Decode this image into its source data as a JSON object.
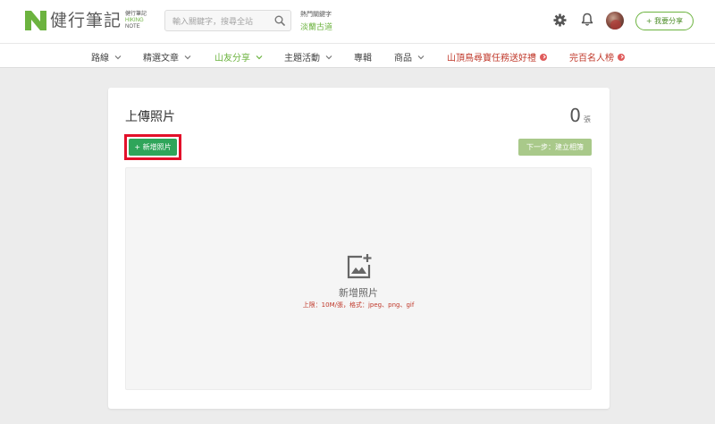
{
  "brand": {
    "name": "健行筆記",
    "sub_cn": "健行筆記",
    "sub_en1": "HIKING",
    "sub_en2": "NOTE"
  },
  "search": {
    "placeholder": "輸入關鍵字，搜尋全站"
  },
  "hot": {
    "label": "熱門關鍵字",
    "keyword": "淡蘭古道"
  },
  "header": {
    "share_label": "+ 我要分享"
  },
  "nav": {
    "items": [
      {
        "label": "路線"
      },
      {
        "label": "精選文章"
      },
      {
        "label": "山友分享"
      },
      {
        "label": "主題活動"
      },
      {
        "label": "專輯"
      },
      {
        "label": "商品"
      },
      {
        "label": "山頂鳥尋寶任務送好禮"
      },
      {
        "label": "完百名人榜"
      }
    ]
  },
  "card": {
    "title": "上傳照片",
    "count": "0",
    "count_unit": "張",
    "add_button": "+ 新增照片",
    "next_button": "下一步：建立相簿",
    "dropzone_label": "新增照片",
    "dropzone_limit": "上限：10M/張，格式：jpeg、png、gif"
  },
  "colors": {
    "brand_green": "#6cb33f",
    "button_green": "#2fa55a",
    "highlight_red": "#e3102a",
    "promo_red": "#c0392b"
  }
}
